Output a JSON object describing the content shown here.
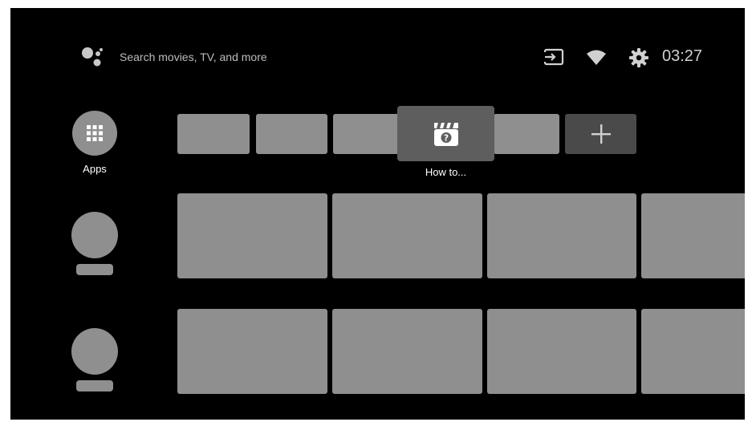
{
  "search": {
    "placeholder": "Search movies, TV, and more"
  },
  "status": {
    "time": "03:27",
    "icons": [
      "input-icon",
      "wifi-icon",
      "gear-icon"
    ]
  },
  "apps": {
    "label": "Apps",
    "icon": "apps-grid-icon"
  },
  "favorites": {
    "focused_label": "How to...",
    "focused_icon": "clapperboard-question-icon",
    "add_icon": "plus-icon"
  },
  "colors": {
    "background": "#000000",
    "tile": "#8f8f8f",
    "focused_tile": "#5e5e5e",
    "add_tile": "#4a4a4a",
    "text": "#ffffff"
  }
}
